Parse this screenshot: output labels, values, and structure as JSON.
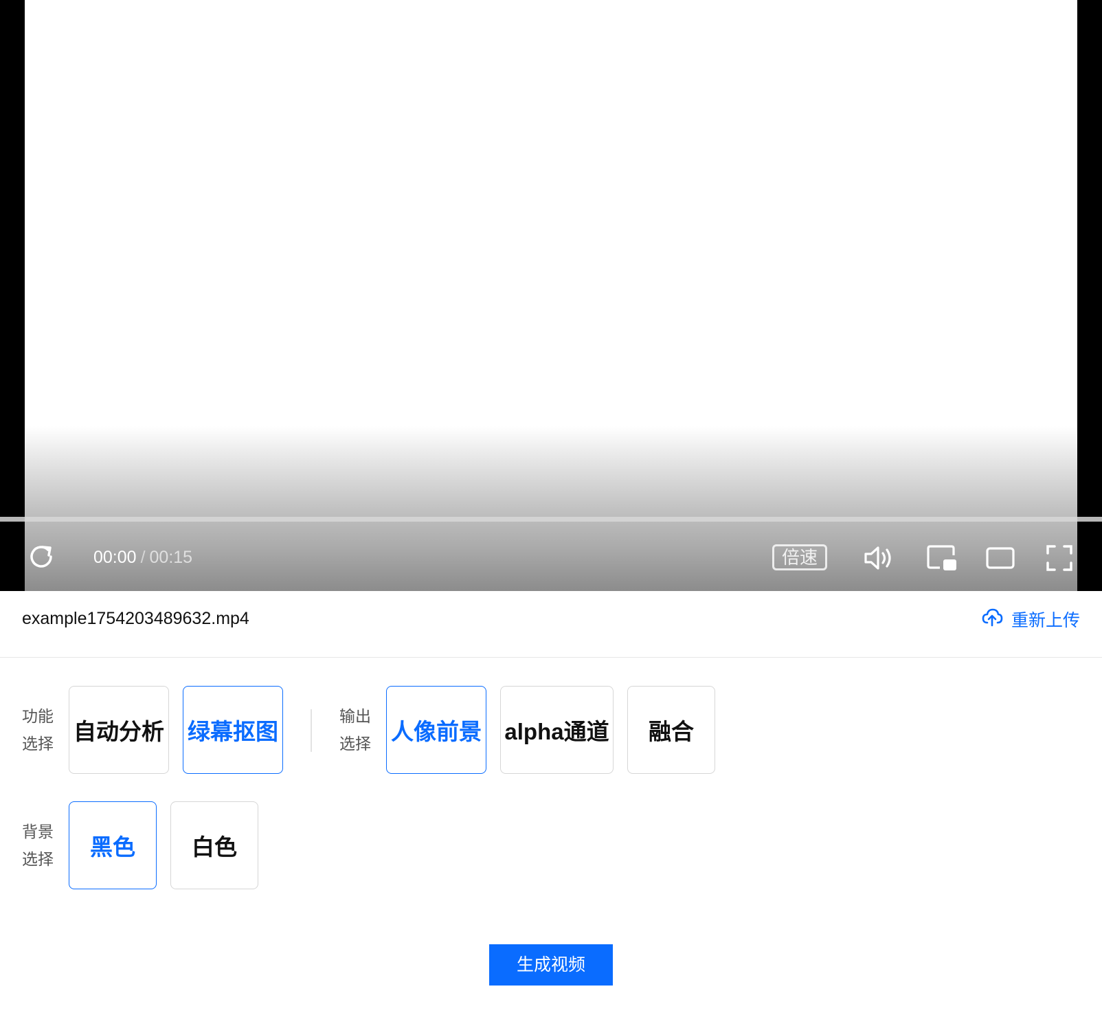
{
  "player": {
    "current_time": "00:00",
    "separator": "/",
    "duration": "00:15",
    "speed_label": "倍速",
    "progress": 0
  },
  "file": {
    "name": "example1754203489632.mp4",
    "reupload_label": "重新上传"
  },
  "function_select": {
    "label_line1": "功能",
    "label_line2": "选择",
    "options": [
      {
        "label": "自动分析",
        "selected": false
      },
      {
        "label": "绿幕抠图",
        "selected": true
      }
    ]
  },
  "output_select": {
    "label_line1": "输出",
    "label_line2": "选择",
    "options": [
      {
        "label": "人像前景",
        "selected": true
      },
      {
        "label": "alpha通道",
        "selected": false
      },
      {
        "label": "融合",
        "selected": false
      }
    ]
  },
  "background_select": {
    "label_line1": "背景",
    "label_line2": "选择",
    "options": [
      {
        "label": "黑色",
        "selected": true
      },
      {
        "label": "白色",
        "selected": false
      }
    ]
  },
  "generate_label": "生成视频",
  "colors": {
    "accent": "#0a6cff",
    "player_bg": "#000000"
  },
  "icons": [
    "replay-icon",
    "volume-icon",
    "pip-icon",
    "wide-screen-icon",
    "fullscreen-icon",
    "cloud-upload-icon"
  ]
}
